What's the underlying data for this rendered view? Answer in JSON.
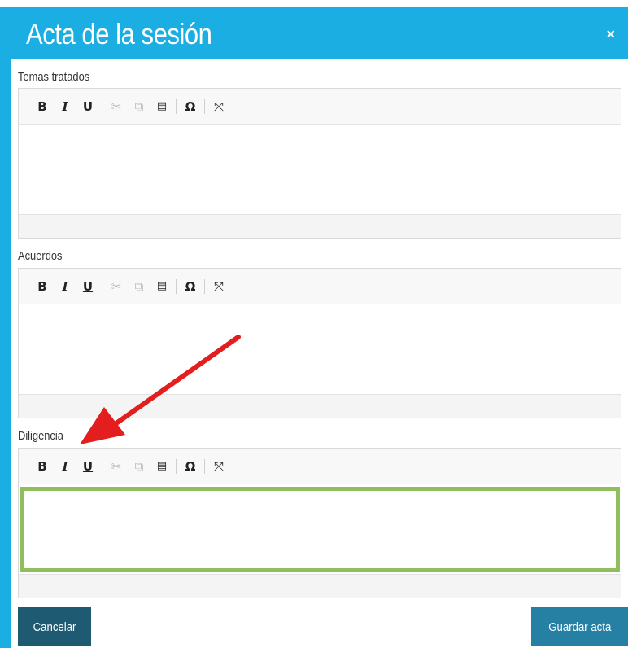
{
  "dialog": {
    "title": "Acta de la sesión",
    "close_label": "×"
  },
  "toolbar": {
    "bold": "B",
    "italic": "I",
    "underline": "U",
    "cut_icon": "✂",
    "copy_icon": "⧉",
    "paste_icon": "📋",
    "special_char": "Ω",
    "maximize_icon": "⛶"
  },
  "fields": [
    {
      "label": "Temas tratados",
      "value": ""
    },
    {
      "label": "Acuerdos",
      "value": ""
    },
    {
      "label": "Diligencia",
      "value": ""
    }
  ],
  "buttons": {
    "cancel": "Cancelar",
    "save": "Guardar acta"
  },
  "colors": {
    "header": "#1aaee2",
    "highlight": "#8fbe5c",
    "arrow": "#e31e1e",
    "cancel_button": "#1e5b72",
    "save_button": "#2680a3"
  }
}
